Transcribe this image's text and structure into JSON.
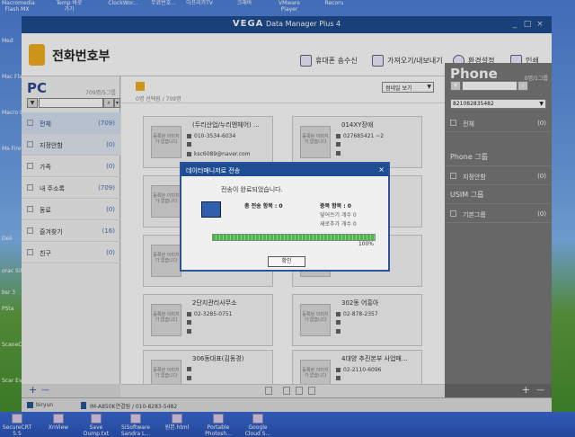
{
  "desktop": {
    "top_labels": [
      "Macromedia Flash MX",
      "Temp 바로 가기",
      "ClockWor...",
      "무료번호...",
      "아프리카TV",
      "크래바",
      "VMware Player",
      "Recoru"
    ],
    "left_labels": [
      "Med",
      "Mac Fla",
      "Macro Dreamv",
      "Ma Firew",
      "Deli",
      "orac Sit",
      "bsr 3",
      "PSta",
      "ScaneCam",
      "Scar Eve"
    ],
    "right_label": "SecureCRT 5.5"
  },
  "window": {
    "title_brand": "VEGA",
    "title_rest": "Data Manager Plus 4",
    "buttons": [
      "_",
      "□",
      "×"
    ]
  },
  "header": {
    "app_name": "전화번호부",
    "toolbar": [
      {
        "label": "휴대폰 송수신"
      },
      {
        "label": "가져오기/내보내기"
      },
      {
        "label": "환경설정"
      },
      {
        "label": "인쇄"
      }
    ]
  },
  "pc_panel": {
    "title": "PC",
    "count": "709명/5그룹",
    "groups": [
      {
        "label": "전체",
        "count": "(709)"
      },
      {
        "label": "지정안함",
        "count": "(0)"
      },
      {
        "label": "가족",
        "count": "(0)"
      },
      {
        "label": "내 주소록",
        "count": "(709)"
      },
      {
        "label": "동료",
        "count": "(0)"
      },
      {
        "label": "즐겨찾기",
        "count": "(16)"
      },
      {
        "label": "친구",
        "count": "(0)"
      }
    ],
    "footer_add": "+",
    "footer_remove": "—"
  },
  "center": {
    "selected_count": "0명 선택됨 / 709명",
    "view_select": "썸네일 보기",
    "photo_placeholder": "등록된 이미지가 없습니다",
    "cards": [
      {
        "name": "(두리산업/누리엔헤어) ...",
        "phone": "010-3534-6034",
        "line2": "",
        "email": "ksc6089@naver.com"
      },
      {
        "name": "014XY장애",
        "phone": "027685421 ~2",
        "line2": "",
        "email": ""
      },
      {
        "name": "",
        "phone": "",
        "line2": "",
        "email": ""
      },
      {
        "name": "",
        "phone": "",
        "line2": "",
        "email": ""
      },
      {
        "name": "",
        "phone": "",
        "line2": "",
        "email": ""
      },
      {
        "name": "",
        "phone": "",
        "line2": "",
        "email": ""
      },
      {
        "name": "2단지관리사무소",
        "phone": "02-3285-0751",
        "line2": "",
        "email": ""
      },
      {
        "name": "302동 어흥아",
        "phone": "02-878-2357",
        "line2": "",
        "email": ""
      },
      {
        "name": "306동대표(김동경)",
        "phone": "",
        "line2": "",
        "email": ""
      },
      {
        "name": "4대양 추진본부 사업매...",
        "phone": "02-2110-6096",
        "line2": "",
        "email": ""
      }
    ]
  },
  "phone_panel": {
    "title": "Phone",
    "count": "0명/1그룹",
    "number_select": "821082835482",
    "items": [
      {
        "type": "item",
        "label": "전체",
        "count": "(0)"
      },
      {
        "type": "group",
        "label": "Phone 그룹"
      },
      {
        "type": "item",
        "label": "지정안함",
        "count": "(0)"
      },
      {
        "type": "group",
        "label": "USIM 그룹"
      },
      {
        "type": "item",
        "label": "기본그룹",
        "count": "(0)"
      }
    ]
  },
  "statusbar": {
    "user": "biryun",
    "device": "IM-A850K연결됨 / 010-8283-5482"
  },
  "taskbar": {
    "items": [
      "XnView",
      "Save Dump.txt",
      "SiSoftware Sandra L...",
      "원본.html",
      "Portable Photosh...",
      "Google Cloud S..."
    ]
  },
  "dialog": {
    "title": "데이터매니저로 전송",
    "message": "전송이 완료되었습니다.",
    "total_label": "총 전송 항목 : 0",
    "dup_label": "중복 항목 : 0",
    "overwrite_label": "덮어쓰기 개수 0",
    "new_label": "새로추가 개수 0",
    "progress": 100,
    "percent_text": "100%",
    "ok_label": "확인"
  }
}
